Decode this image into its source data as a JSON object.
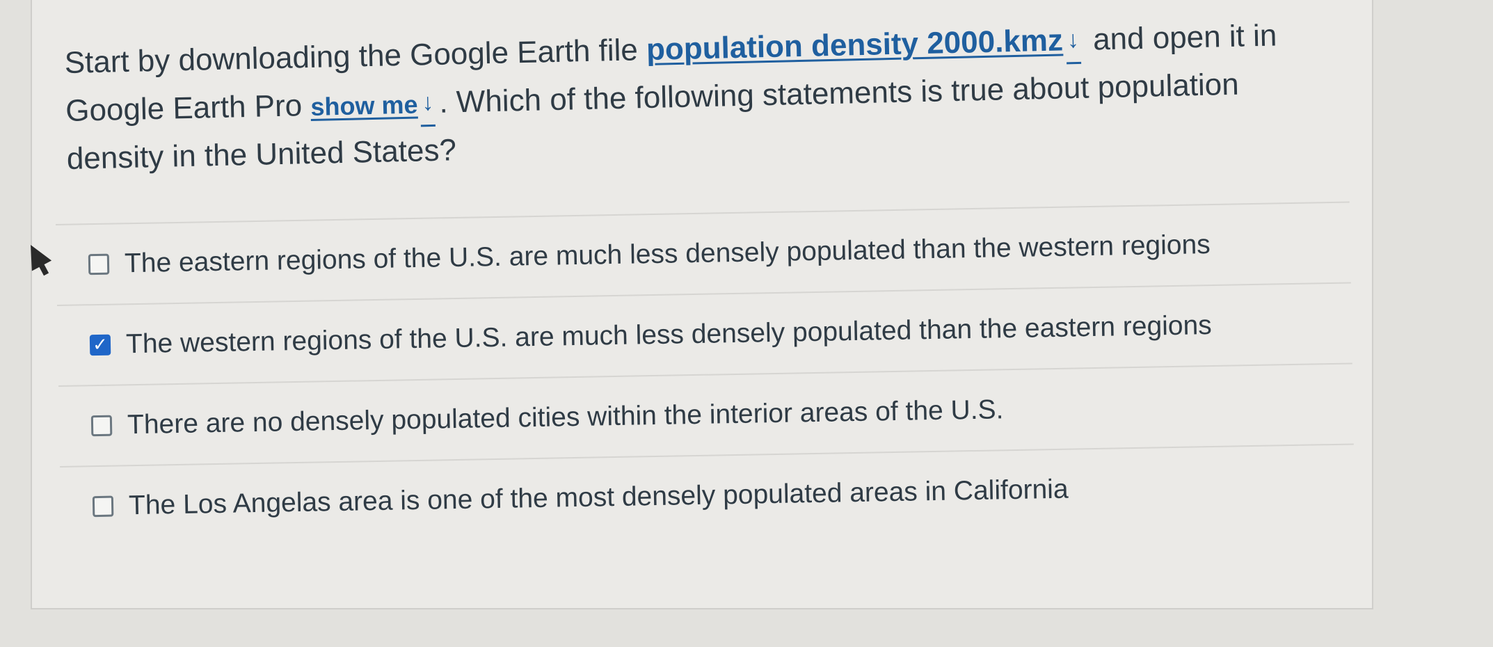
{
  "question": {
    "text_before_link": "Start by downloading the Google Earth file ",
    "file_link": "population density 2000.kmz",
    "text_after_link": " and open it in Google Earth Pro ",
    "show_me_link": "show me",
    "text_after_show_me": ". Which of the following statements is true about population density in the United States?"
  },
  "icons": {
    "download": "↓"
  },
  "answers": [
    {
      "label": "The eastern regions of the U.S. are much less densely populated than the western regions",
      "checked": false
    },
    {
      "label": "The western regions of the U.S. are much less densely populated than the eastern regions",
      "checked": true
    },
    {
      "label": "There are no densely populated cities within the interior areas of the U.S.",
      "checked": false
    },
    {
      "label": "The Los Angelas area is one of the most densely populated areas in California",
      "checked": false
    }
  ],
  "colors": {
    "link": "#1f5f9f",
    "checkbox_checked": "#1f66c8"
  }
}
